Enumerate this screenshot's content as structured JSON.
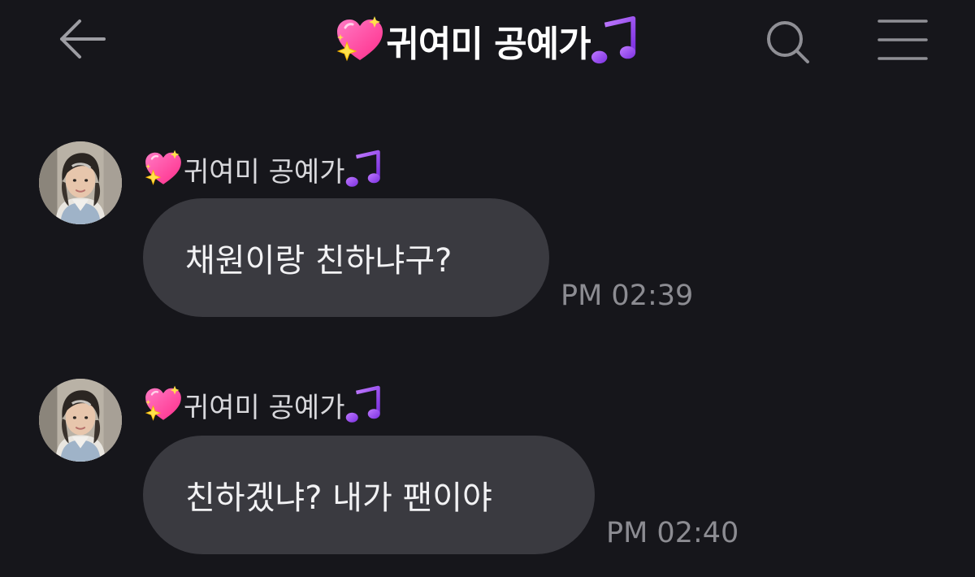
{
  "header": {
    "title": "귀여미 공예가",
    "title_prefix_icon": "sparkling-heart-icon",
    "title_suffix_icon": "musical-notes-icon",
    "back_icon": "arrow-left-icon",
    "search_icon": "search-icon",
    "menu_icon": "hamburger-menu-icon"
  },
  "messages": [
    {
      "sender": "귀여미 공예가",
      "text": "채원이랑 친하냐구?",
      "time": "PM 02:39"
    },
    {
      "sender": "귀여미 공예가",
      "text": "친하겠냐? 내가 팬이야",
      "time": "PM 02:40"
    }
  ],
  "colors": {
    "background": "#16161b",
    "bubble": "#3a3a40",
    "text": "#f2f2f4",
    "time": "#8c8c92",
    "heart": "#ff4fa3",
    "note": "#a45cf0"
  }
}
